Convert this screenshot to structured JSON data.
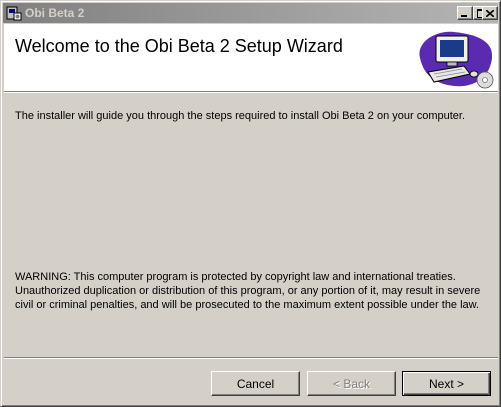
{
  "window": {
    "title": "Obi Beta 2",
    "controls": {
      "minimize": "minimize-icon",
      "maximize": "maximize-icon",
      "close": "close-icon"
    }
  },
  "header": {
    "title": "Welcome to the Obi Beta 2 Setup Wizard",
    "graphic": "computer-setup-graphic"
  },
  "content": {
    "intro": "The installer will guide you through the steps required to install Obi Beta 2 on your computer.",
    "warning": "WARNING: This computer program is protected by copyright law and international treaties. Unauthorized duplication or distribution of this program, or any portion of it, may result in severe civil or criminal penalties, and will be prosecuted to the maximum extent possible under the law."
  },
  "buttons": {
    "cancel": "Cancel",
    "back": "< Back",
    "next": "Next >"
  },
  "colors": {
    "face": "#d4d0c8",
    "titlebar_inactive": "#808080",
    "header_bg": "#ffffff"
  }
}
